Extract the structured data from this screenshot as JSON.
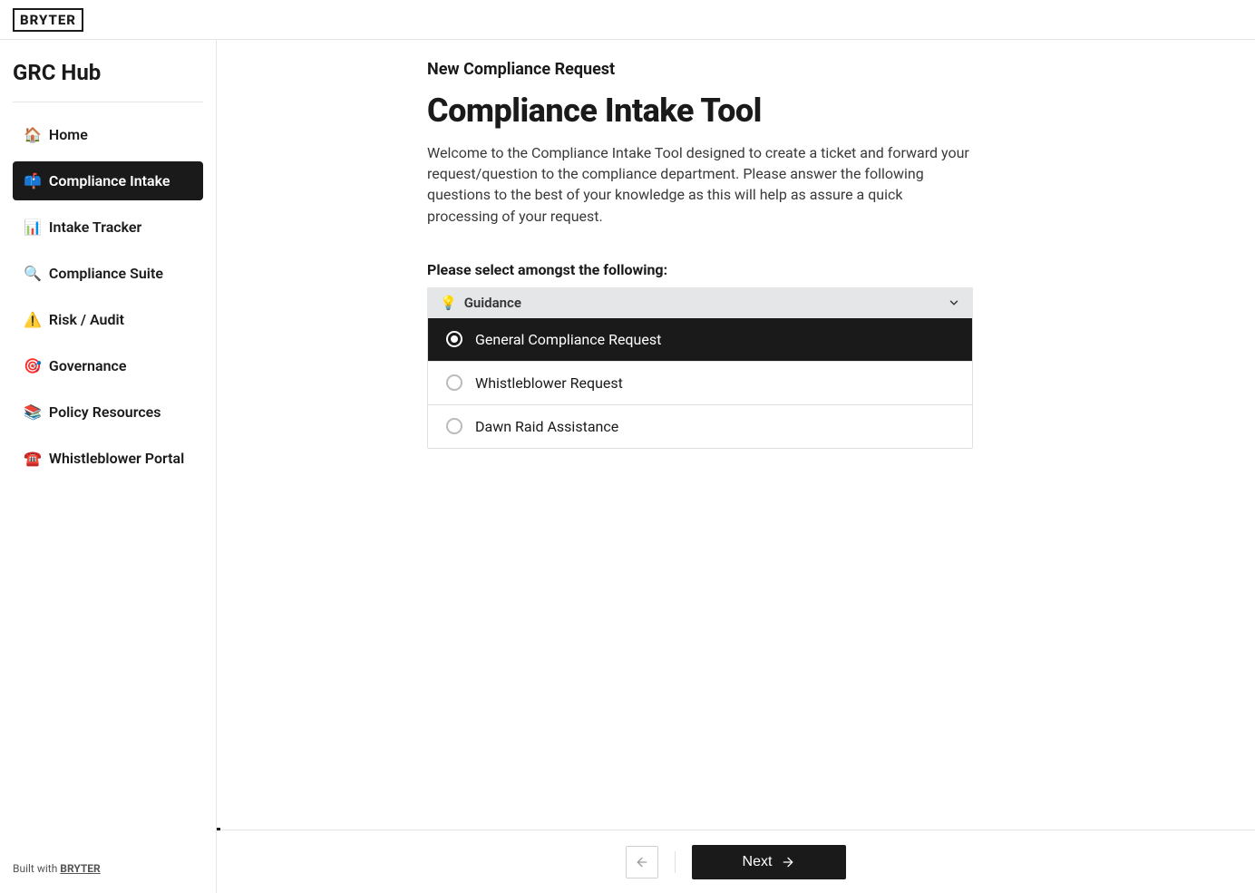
{
  "header": {
    "logo_text": "BRYTER"
  },
  "sidebar": {
    "title": "GRC Hub",
    "items": [
      {
        "icon": "🏠",
        "label": "Home",
        "name": "sidebar-item-home",
        "active": false
      },
      {
        "icon": "📫",
        "label": "Compliance Intake",
        "name": "sidebar-item-compliance-intake",
        "active": true
      },
      {
        "icon": "📊",
        "label": "Intake Tracker",
        "name": "sidebar-item-intake-tracker",
        "active": false
      },
      {
        "icon": "🔍",
        "label": "Compliance Suite",
        "name": "sidebar-item-compliance-suite",
        "active": false
      },
      {
        "icon": "⚠️",
        "label": "Risk / Audit",
        "name": "sidebar-item-risk-audit",
        "active": false
      },
      {
        "icon": "🎯",
        "label": "Governance",
        "name": "sidebar-item-governance",
        "active": false
      },
      {
        "icon": "📚",
        "label": "Policy Resources",
        "name": "sidebar-item-policy-resources",
        "active": false
      },
      {
        "icon": "☎️",
        "label": "Whistleblower Portal",
        "name": "sidebar-item-whistleblower-portal",
        "active": false
      }
    ],
    "footer_prefix": "Built with ",
    "footer_link": "BRYTER"
  },
  "main": {
    "breadcrumb": "New Compliance Request",
    "title": "Compliance Intake Tool",
    "intro": "Welcome to the Compliance Intake Tool designed to create a ticket and forward your request/question to the compliance department. Please answer the following questions to the best of your knowledge as this will help as assure a quick processing of your request.",
    "question_label": "Please select amongst the following:",
    "guidance_icon": "💡",
    "guidance_label": "Guidance",
    "options": [
      {
        "label": "General Compliance Request",
        "selected": true
      },
      {
        "label": "Whistleblower Request",
        "selected": false
      },
      {
        "label": "Dawn Raid Assistance",
        "selected": false
      }
    ]
  },
  "footer": {
    "next_label": "Next"
  }
}
